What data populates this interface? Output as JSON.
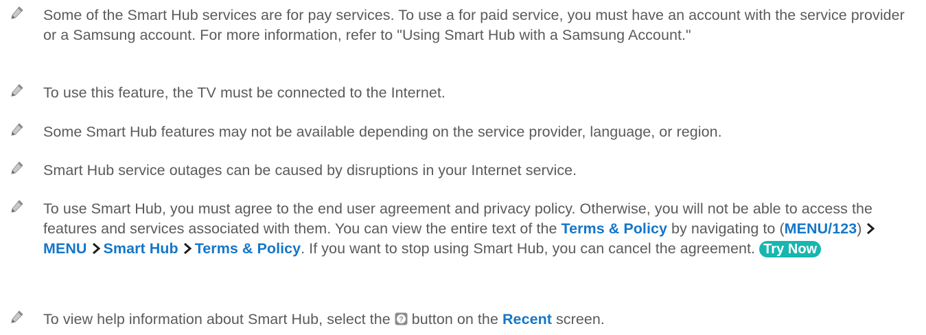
{
  "notes": [
    {
      "text": "Some of the Smart Hub services are for pay services. To use a for paid service, you must have an account with the service provider or a Samsung account. For more information, refer to \"Using Smart Hub with a Samsung Account.\""
    },
    {
      "text": "To use this feature, the TV must be connected to the Internet."
    },
    {
      "text": "Some Smart Hub features may not be available depending on the service provider, language, or region."
    },
    {
      "text": "Smart Hub service outages can be caused by disruptions in your Internet service."
    },
    {
      "text_before": "To use Smart Hub, you must agree to the end user agreement and privacy policy. Otherwise, you will not be able to access the features and services associated with them. You can view the entire text of the ",
      "link_terms": "Terms & Policy",
      "text_nav_intro": " by navigating to (",
      "menu_key": "MENU/123",
      "text_paren_close": ")",
      "path": [
        "MENU",
        "Smart Hub",
        "Terms & Policy"
      ],
      "text_after": ". If you want to stop using Smart Hub, you can cancel the agreement. ",
      "button_label": "Try Now"
    },
    {
      "text_before": "To view help information about Smart Hub, select the ",
      "text_middle": " button on the ",
      "link_recent": "Recent",
      "text_after": " screen."
    }
  ],
  "icons": {
    "note": "pencil-icon",
    "help": "help-icon",
    "path_separator": "chevron-right-icon"
  },
  "colors": {
    "text": "#5a5a5a",
    "link": "#1576c9",
    "button_bg": "#17b6b0"
  }
}
